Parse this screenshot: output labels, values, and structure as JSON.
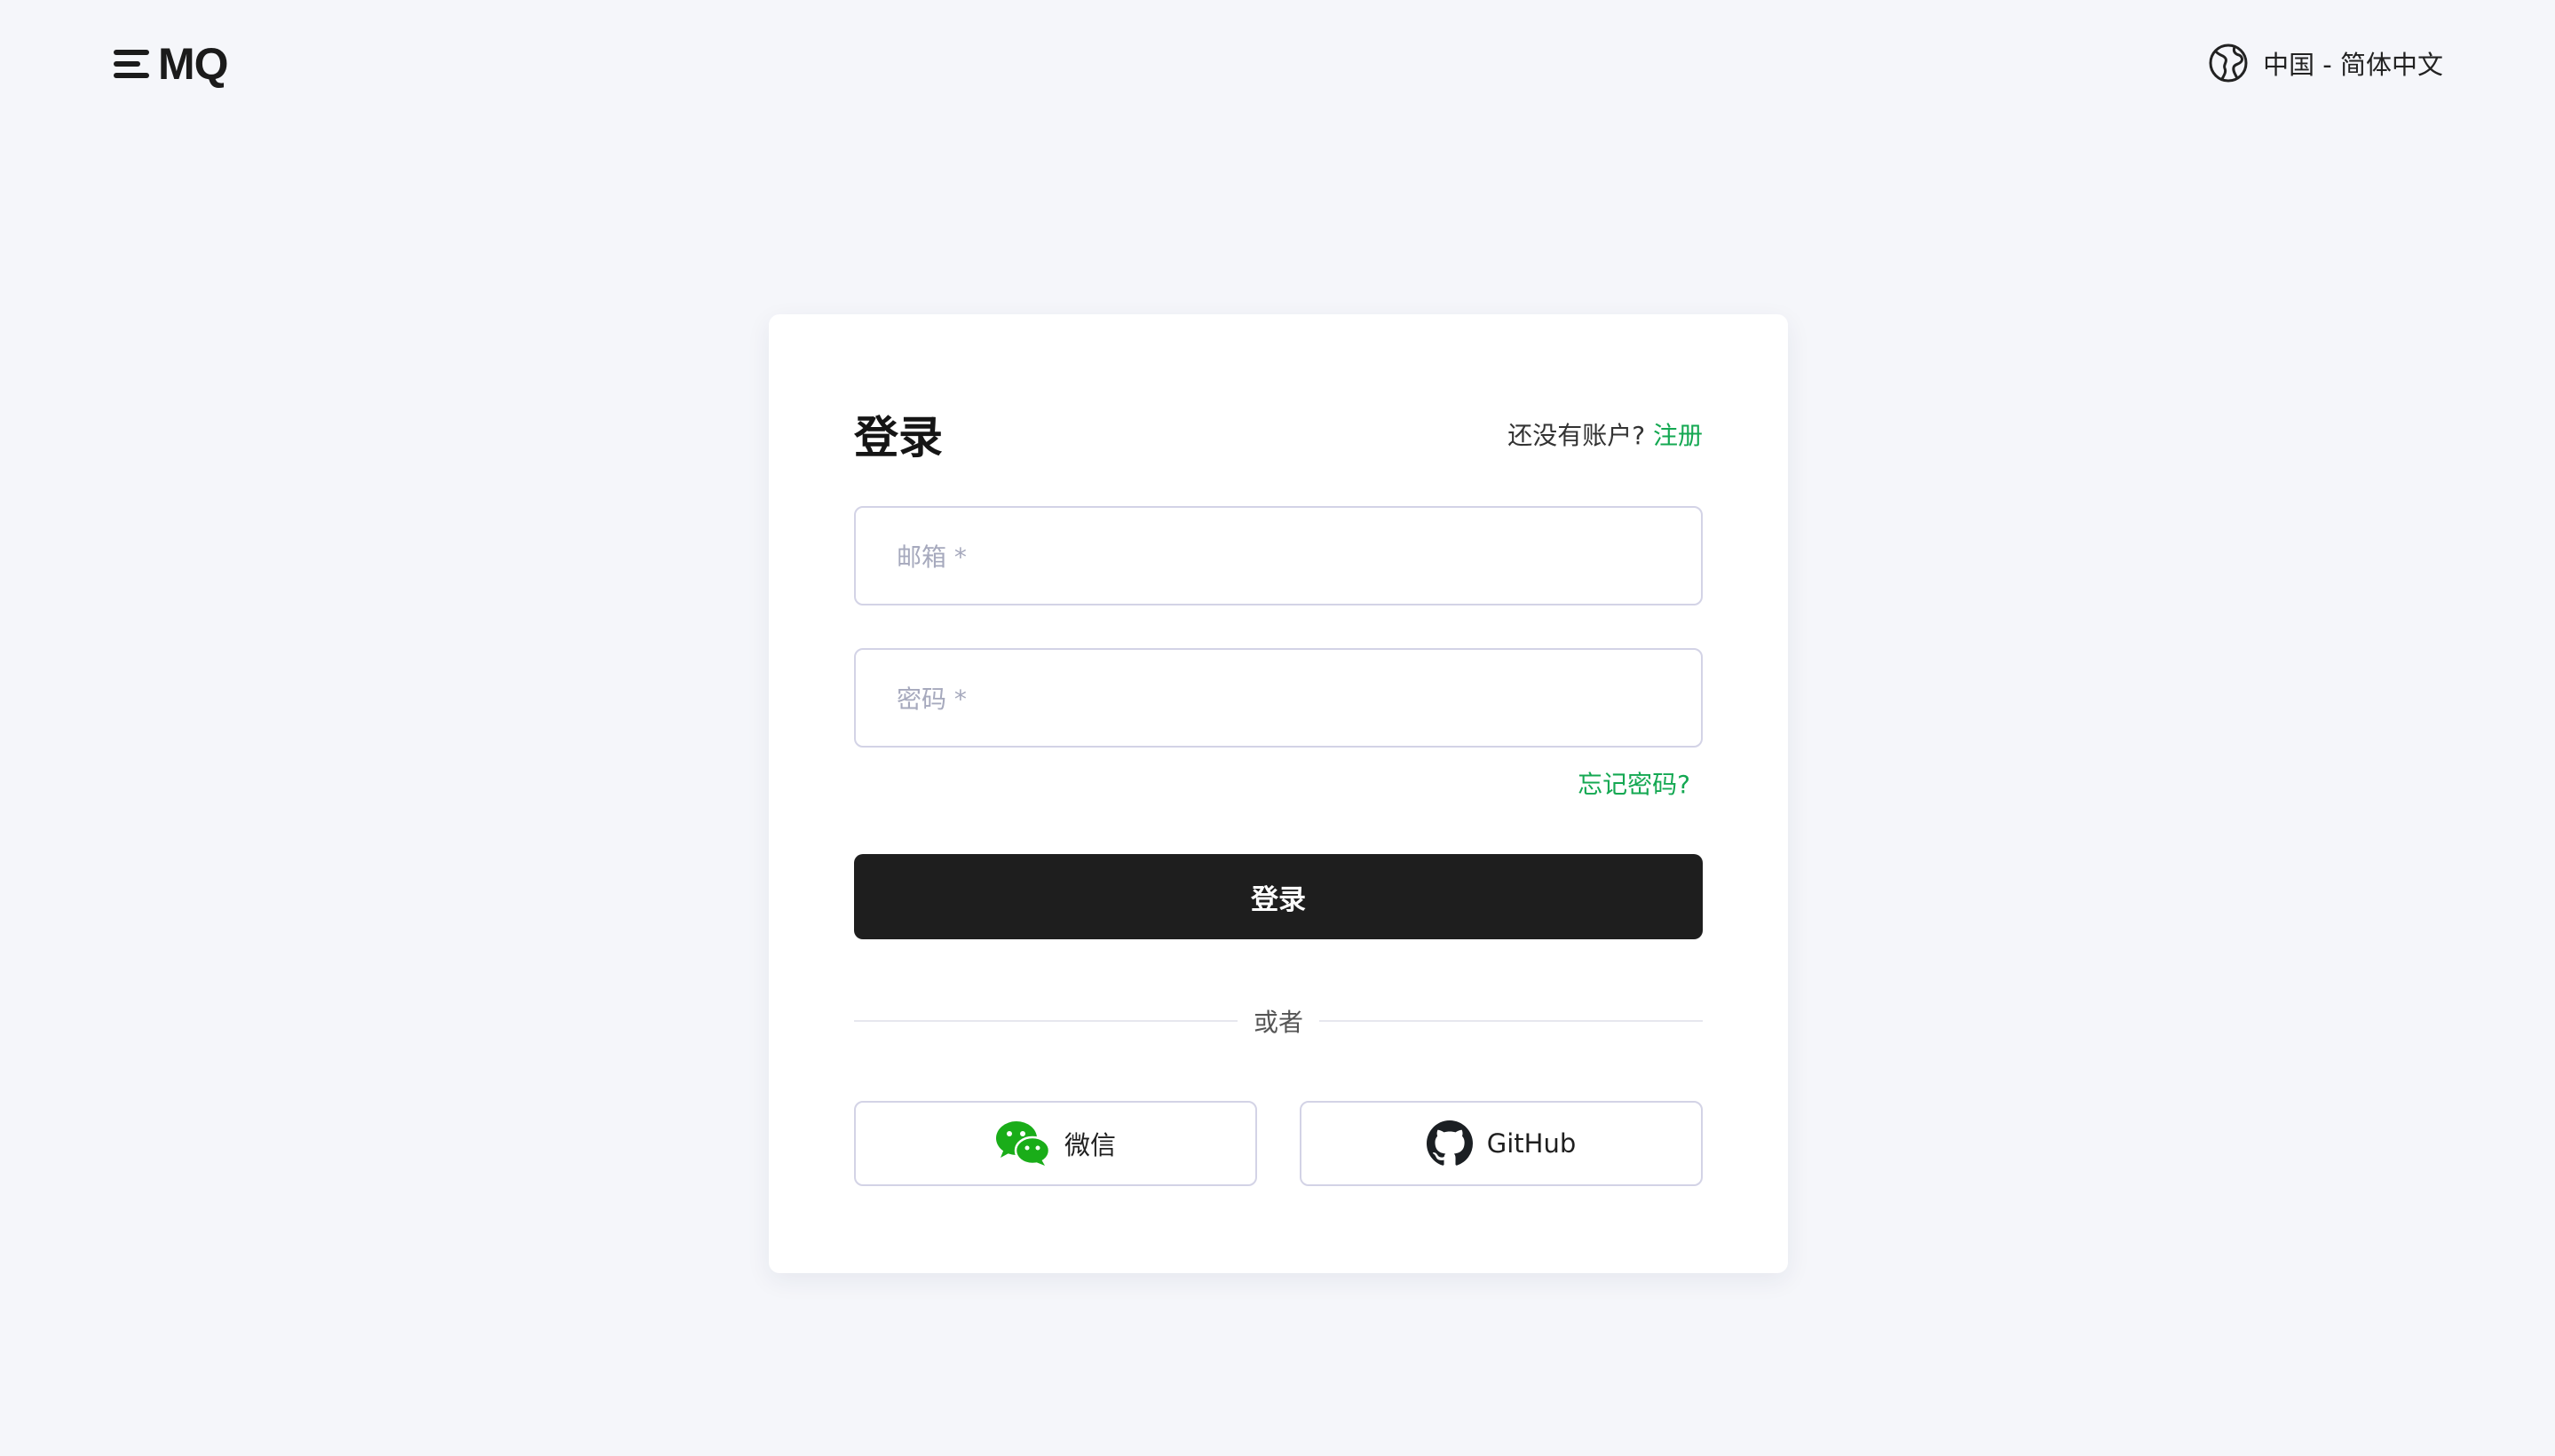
{
  "header": {
    "logo_text": "MQ",
    "language_label": "中国 - 简体中文"
  },
  "login": {
    "title": "登录",
    "no_account_text": "还没有账户?",
    "signup_link": "注册",
    "email_placeholder": "邮箱 *",
    "password_placeholder": "密码 *",
    "forgot_password": "忘记密码?",
    "submit_label": "登录",
    "divider_text": "或者",
    "wechat_label": "微信",
    "github_label": "GitHub"
  },
  "colors": {
    "accent": "#14a852",
    "primary_button": "#1e1e1e",
    "background": "#f5f6fa"
  },
  "icons": {
    "language": "globe-icon",
    "wechat": "wechat-icon",
    "github": "github-icon"
  }
}
